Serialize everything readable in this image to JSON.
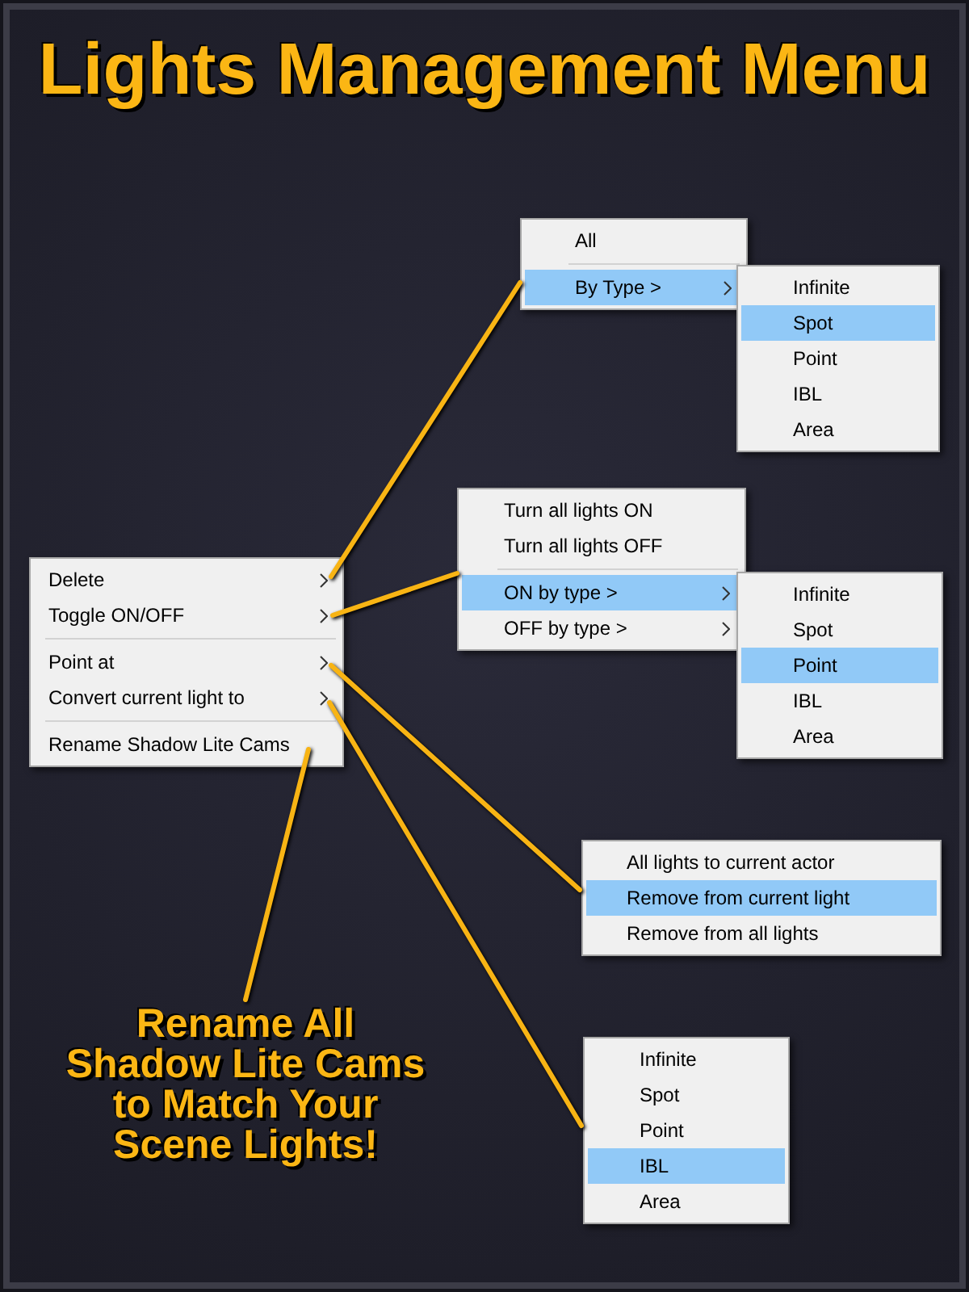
{
  "title": "Lights Management Menu",
  "context_menu": {
    "items": [
      {
        "kind": "item",
        "label": "Delete",
        "submenu": true,
        "selected": false
      },
      {
        "kind": "item",
        "label": "Toggle ON/OFF",
        "submenu": true,
        "selected": false
      },
      {
        "kind": "separator"
      },
      {
        "kind": "item",
        "label": "Point at",
        "submenu": true,
        "selected": false
      },
      {
        "kind": "item",
        "label": "Convert current light to",
        "submenu": true,
        "selected": false
      },
      {
        "kind": "separator"
      },
      {
        "kind": "item",
        "label": "Rename Shadow Lite Cams",
        "submenu": false,
        "selected": false
      }
    ]
  },
  "submenus": [
    {
      "items": [
        {
          "kind": "item",
          "label": "All",
          "submenu": false,
          "selected": false
        },
        {
          "kind": "separator"
        },
        {
          "kind": "item",
          "label": "By Type >",
          "submenu": true,
          "selected": true
        }
      ]
    },
    {
      "items": [
        {
          "kind": "item",
          "label": "Infinite",
          "submenu": false,
          "selected": false
        },
        {
          "kind": "item",
          "label": "Spot",
          "submenu": false,
          "selected": true
        },
        {
          "kind": "item",
          "label": "Point",
          "submenu": false,
          "selected": false
        },
        {
          "kind": "item",
          "label": "IBL",
          "submenu": false,
          "selected": false
        },
        {
          "kind": "item",
          "label": "Area",
          "submenu": false,
          "selected": false
        }
      ]
    },
    {
      "items": [
        {
          "kind": "item",
          "label": "Turn all lights ON",
          "submenu": false,
          "selected": false
        },
        {
          "kind": "item",
          "label": "Turn all lights OFF",
          "submenu": false,
          "selected": false
        },
        {
          "kind": "separator"
        },
        {
          "kind": "item",
          "label": "ON by type >",
          "submenu": true,
          "selected": true
        },
        {
          "kind": "item",
          "label": "OFF by type >",
          "submenu": true,
          "selected": false
        }
      ]
    },
    {
      "items": [
        {
          "kind": "item",
          "label": "Infinite",
          "submenu": false,
          "selected": false
        },
        {
          "kind": "item",
          "label": "Spot",
          "submenu": false,
          "selected": false
        },
        {
          "kind": "item",
          "label": "Point",
          "submenu": false,
          "selected": true
        },
        {
          "kind": "item",
          "label": "IBL",
          "submenu": false,
          "selected": false
        },
        {
          "kind": "item",
          "label": "Area",
          "submenu": false,
          "selected": false
        }
      ]
    },
    {
      "items": [
        {
          "kind": "item",
          "label": "All lights to current actor",
          "submenu": false,
          "selected": false
        },
        {
          "kind": "item",
          "label": "Remove from current light",
          "submenu": false,
          "selected": true
        },
        {
          "kind": "item",
          "label": "Remove from all lights",
          "submenu": false,
          "selected": false
        }
      ]
    },
    {
      "items": [
        {
          "kind": "item",
          "label": "Infinite",
          "submenu": false,
          "selected": false
        },
        {
          "kind": "item",
          "label": "Spot",
          "submenu": false,
          "selected": false
        },
        {
          "kind": "item",
          "label": "Point",
          "submenu": false,
          "selected": false
        },
        {
          "kind": "item",
          "label": "IBL",
          "submenu": false,
          "selected": true
        },
        {
          "kind": "item",
          "label": "Area",
          "submenu": false,
          "selected": false
        }
      ]
    }
  ],
  "caption": {
    "lines": [
      "Rename All",
      "Shadow Lite Cams",
      "to Match Your",
      "Scene Lights!"
    ]
  }
}
